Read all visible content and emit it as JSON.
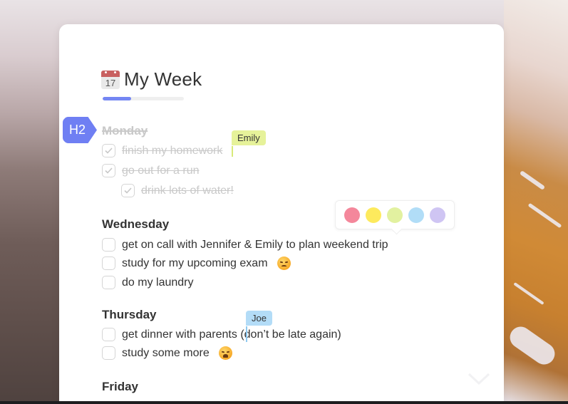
{
  "page": {
    "title": "My Week",
    "title_icon": "calendar-icon",
    "calendar_day": "17",
    "progress_percent": 35,
    "accent_color": "#7486f3"
  },
  "block_badge": {
    "label": "H2",
    "color": "#6f7ff3"
  },
  "sections": [
    {
      "title": "Monday",
      "completed": true,
      "tasks": [
        {
          "label": "finish my homework",
          "checked": true,
          "indent": 0
        },
        {
          "label": "go out for a run",
          "checked": true,
          "indent": 0
        },
        {
          "label": "drink lots of water!",
          "checked": true,
          "indent": 1
        }
      ]
    },
    {
      "title": "Wednesday",
      "completed": false,
      "tasks": [
        {
          "label": "get on call with Jennifer & Emily to plan weekend trip",
          "checked": false,
          "indent": 0
        },
        {
          "label": "study for my upcoming exam",
          "checked": false,
          "indent": 0,
          "emoji": "persevering-face"
        },
        {
          "label": "do my laundry",
          "checked": false,
          "indent": 0
        }
      ]
    },
    {
      "title": "Thursday",
      "completed": false,
      "tasks": [
        {
          "label": "get dinner with parents",
          "label_after_cursor": "(don’t be late again)",
          "checked": false,
          "indent": 0
        },
        {
          "label": "study some more",
          "checked": false,
          "indent": 0,
          "emoji": "weary-face"
        }
      ]
    },
    {
      "title": "Friday",
      "completed": false,
      "tasks": []
    }
  ],
  "collaborator_cursors": [
    {
      "name": "Emily",
      "color": "#e6f29a"
    },
    {
      "name": "Joe",
      "color": "#b3dcf7"
    }
  ],
  "color_palette": {
    "swatches": [
      {
        "name": "pink",
        "color": "#f4879b"
      },
      {
        "name": "yellow",
        "color": "#fdea5d"
      },
      {
        "name": "lime",
        "color": "#e2f1a0"
      },
      {
        "name": "blue",
        "color": "#b1ddf7"
      },
      {
        "name": "lavender",
        "color": "#cfc5f3"
      }
    ]
  },
  "scroll_indicator": "chevron-down-icon"
}
